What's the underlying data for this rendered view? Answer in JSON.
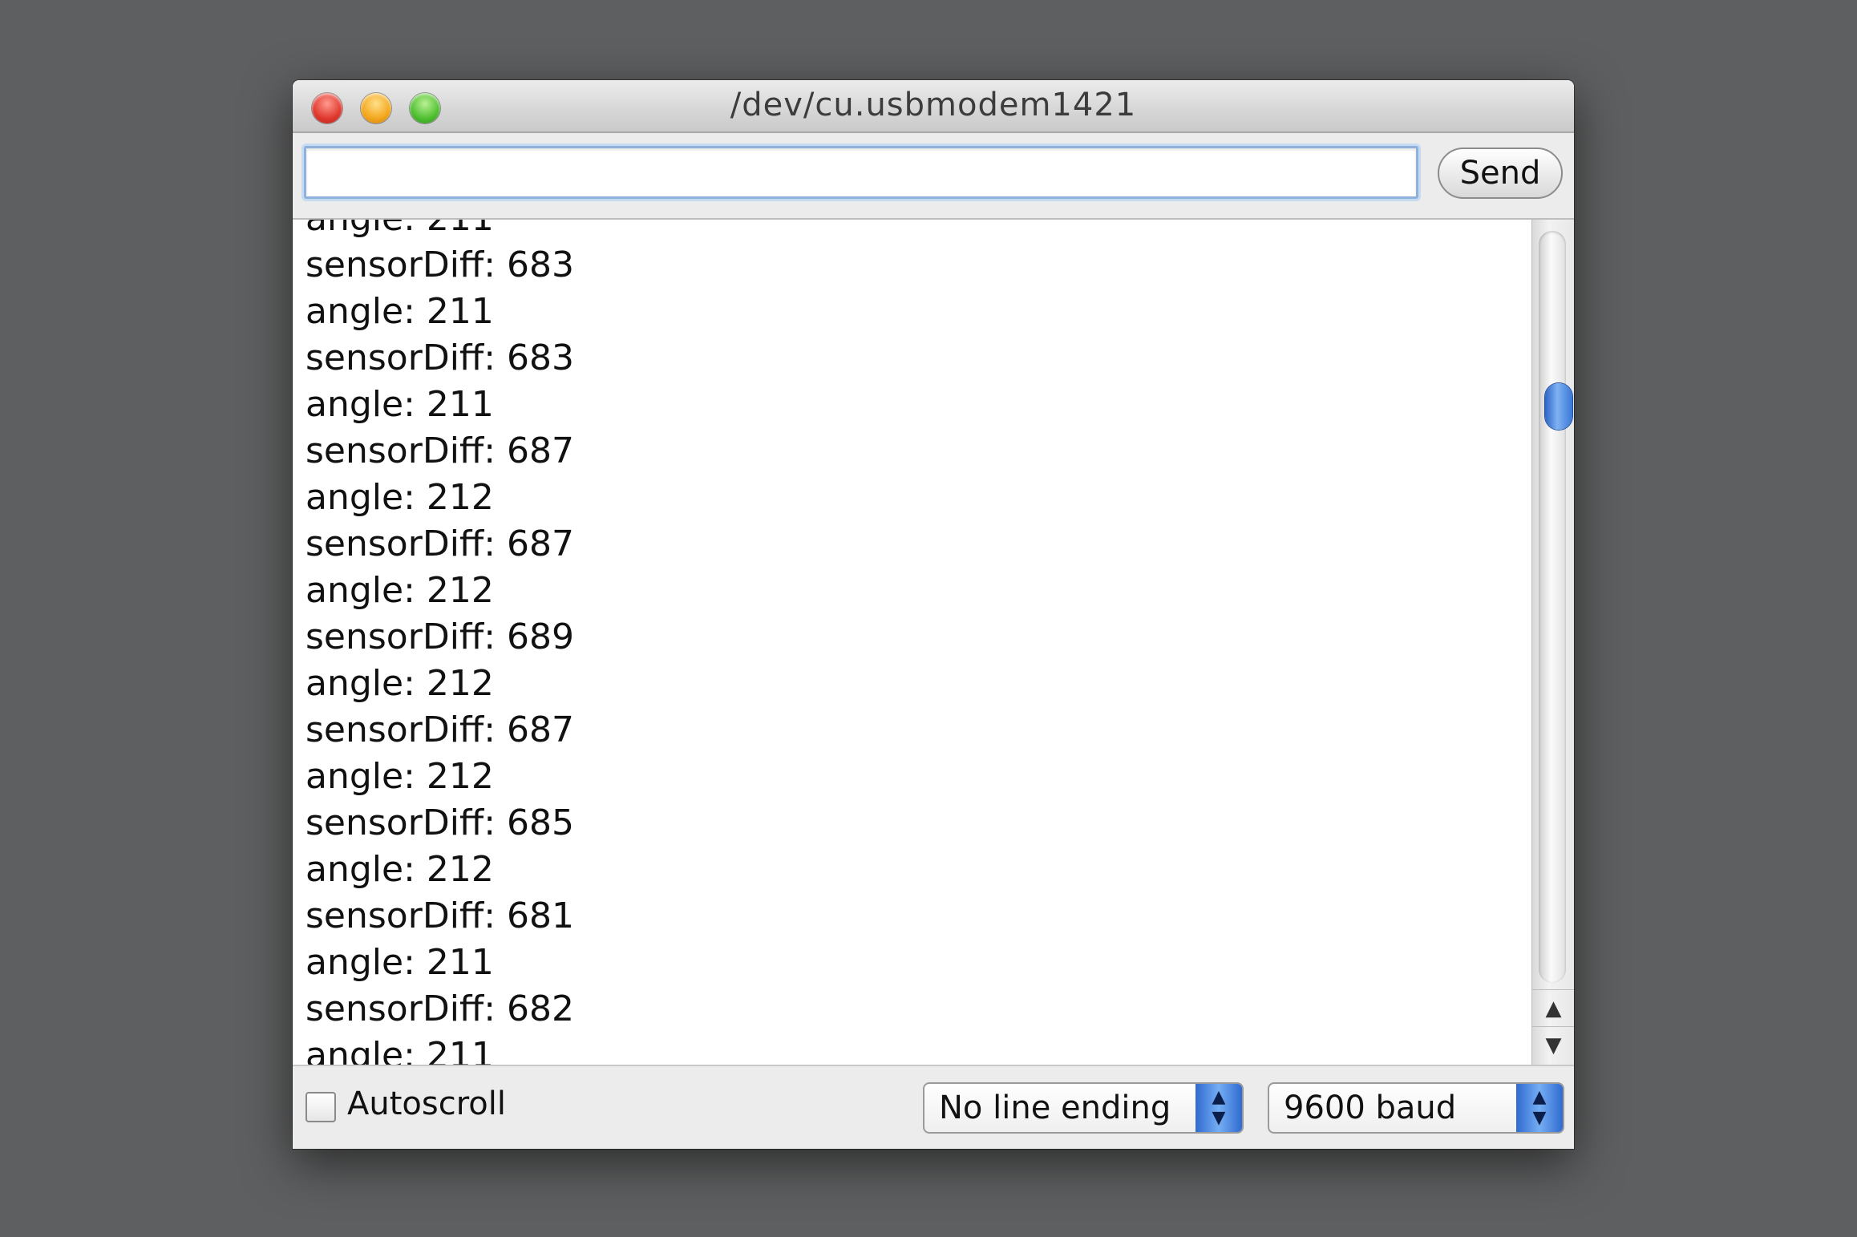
{
  "window": {
    "title": "/dev/cu.usbmodem1421"
  },
  "toolbar": {
    "input_value": "",
    "send_label": "Send"
  },
  "console": {
    "lines": [
      "angle: 211",
      "sensorDiff: 683",
      "angle: 211",
      "sensorDiff: 683",
      "angle: 211",
      "sensorDiff: 687",
      "angle: 212",
      "sensorDiff: 687",
      "angle: 212",
      "sensorDiff: 689",
      "angle: 212",
      "sensorDiff: 687",
      "angle: 212",
      "sensorDiff: 685",
      "angle: 212",
      "sensorDiff: 681",
      "angle: 211",
      "sensorDiff: 682",
      "angle: 211"
    ]
  },
  "footer": {
    "autoscroll_label": "Autoscroll",
    "autoscroll_checked": false,
    "line_ending": "No line ending",
    "baud_rate": "9600 baud"
  },
  "scrollbar": {
    "position_fraction": 0.2
  },
  "colors": {
    "desktop": "#5e5f60",
    "accent": "#3a77d6",
    "close": "#e0382e",
    "minimize": "#f3a71d",
    "zoom": "#4fbf31"
  },
  "icons": [
    "close-button-icon",
    "minimize-button-icon",
    "zoom-button-icon",
    "scroll-up-arrow-icon",
    "scroll-down-arrow-icon",
    "stepper-arrows-icon"
  ]
}
